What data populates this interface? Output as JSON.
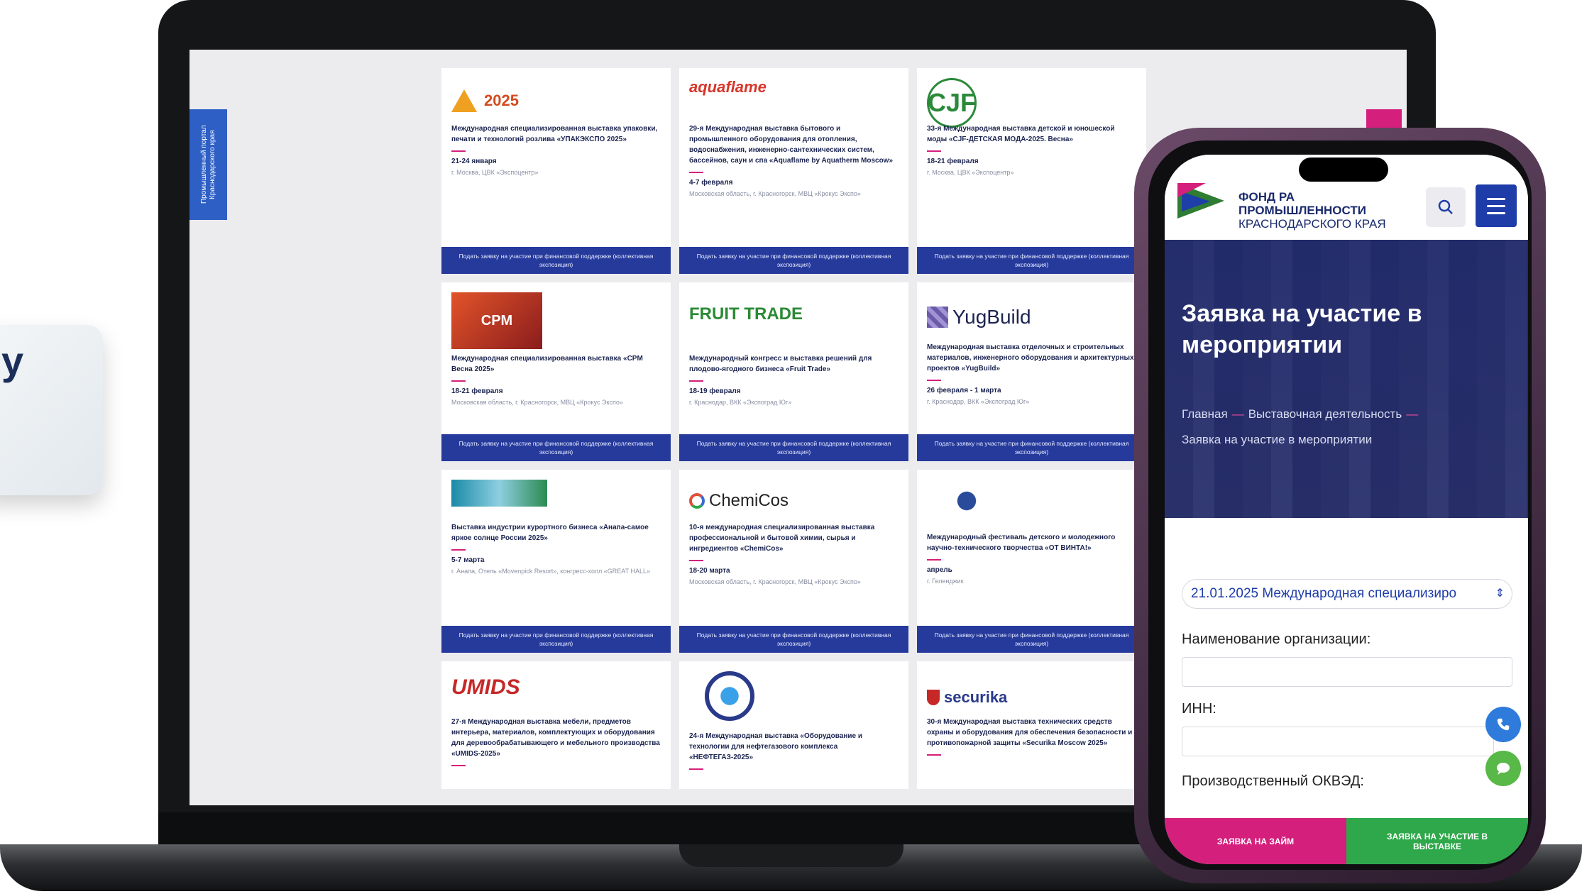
{
  "side_card": {
    "glyph": "у"
  },
  "laptop": {
    "portal_tab": "Промышленный портал Краснодарского края",
    "cards": [
      {
        "logo_year": "2025",
        "title": "Международная специализированная выставка упаковки, печати и технологий розлива «УПАКЭКСПО 2025»",
        "date": "21-24 января",
        "place": "г. Москва, ЦВК «Экспоцентр»",
        "button": "Подать заявку на участие при финансовой поддержке (коллективная экспозиция)"
      },
      {
        "logo_text": "aquaflame",
        "title": "29-я Международная выставка бытового и промышленного оборудования для отопления, водоснабжения, инженерно-сантехнических систем, бассейнов, саун и спа «Aquaflame by Aquatherm Moscow»",
        "date": "4-7 февраля",
        "place": "Московская область, г. Красногорск, МВЦ «Крокус Экспо»",
        "button": "Подать заявку на участие при финансовой поддержке (коллективная экспозиция)"
      },
      {
        "logo_text": "CJF",
        "title": "33-я Международная выставка детской и юношеской моды «CJF-ДЕТСКАЯ МОДА-2025. Весна»",
        "date": "18-21 февраля",
        "place": "г. Москва, ЦВК «Экспоцентр»",
        "button": "Подать заявку на участие при финансовой поддержке (коллективная экспозиция)"
      },
      {
        "logo_text": "CPM",
        "title": "Международная специализированная выставка «CPM Весна 2025»",
        "date": "18-21 февраля",
        "place": "Московская область, г. Красногорск, МВЦ «Крокус Экспо»",
        "button": "Подать заявку на участие при финансовой поддержке (коллективная экспозиция)"
      },
      {
        "logo_text": "FRUIT TRADE",
        "title": "Международный конгресс и выставка решений для плодово-ягодного бизнеса «Fruit Trade»",
        "date": "18-19 февраля",
        "place": "г. Краснодар, ВКК «Экспоград Юг»",
        "button": "Подать заявку на участие при финансовой поддержке (коллективная экспозиция)"
      },
      {
        "logo_text": "YugBuild",
        "title": "Международная выставка отделочных и строительных материалов, инженерного оборудования и архитектурных проектов «YugBuild»",
        "date": "26 февраля - 1 марта",
        "place": "г. Краснодар, ВКК «Экспоград Юг»",
        "button": "Подать заявку на участие при финансовой поддержке (коллективная экспозиция)"
      },
      {
        "logo_text": "",
        "title": "Выставка индустрии курортного бизнеса «Анапа-самое яркое солнце России 2025»",
        "date": "5-7 марта",
        "place": "г. Анапа, Отель «Movenpick Resort», конгресс-холл «GREAT HALL»",
        "button": "Подать заявку на участие при финансовой поддержке (коллективная экспозиция)"
      },
      {
        "logo_text": "ChemiCos",
        "title": "10-я международная специализированная выставка профессиональной и бытовой химии, сырья и ингредиентов «ChemiCos»",
        "date": "18-20 марта",
        "place": "Московская область, г. Красногорск, МВЦ «Крокус Экспо»",
        "button": "Подать заявку на участие при финансовой поддержке (коллективная экспозиция)"
      },
      {
        "logo_text": "",
        "title": "Международный фестиваль детского и молодежного научно-технического творчества «ОТ ВИНТА!»",
        "date": "апрель",
        "place": "г. Геленджик",
        "button": "Подать заявку на участие при финансовой поддержке (коллективная экспозиция)"
      },
      {
        "logo_text": "UMIDS",
        "title": "27-я Международная выставка мебели, предметов интерьера, материалов, комплектующих и оборудования для деревообрабатывающего и мебельного производства «UMIDS-2025»",
        "date": "",
        "place": "",
        "button": ""
      },
      {
        "logo_text": "",
        "title": "24-я Международная выставка «Оборудование и технологии для нефтегазового комплекса «НЕФТЕГАЗ-2025»",
        "date": "",
        "place": "",
        "button": ""
      },
      {
        "logo_text": "securika",
        "title": "30-я Международная выставка технических средств охраны и оборудования для обеспечения безопасности и противопожарной защиты «Securika Moscow 2025»",
        "date": "",
        "place": "",
        "button": ""
      }
    ]
  },
  "phone": {
    "org_line1": "ФОНД РА",
    "org_line2": "ПРОМЫШЛЕННОСТИ",
    "org_line3": "КРАСНОДАРСКОГО КРАЯ",
    "hero_title": "Заявка на участие в мероприятии",
    "breadcrumb": {
      "home": "Главная",
      "section": "Выставочная деятельность",
      "current": "Заявка на участие в мероприятии"
    },
    "select_value": "21.01.2025 Международная специализиро",
    "label_org": "Наименование организации:",
    "label_inn": "ИНН:",
    "label_okved": "Производственный ОКВЭД:",
    "btn_loan": "ЗАЯВКА НА ЗАЙМ",
    "btn_expo": "ЗАЯВКА НА УЧАСТИЕ В ВЫСТАВКЕ"
  },
  "colors": {
    "brand_blue": "#1f3da8",
    "brand_pink": "#d51f7c",
    "brand_green": "#2ea84a"
  }
}
